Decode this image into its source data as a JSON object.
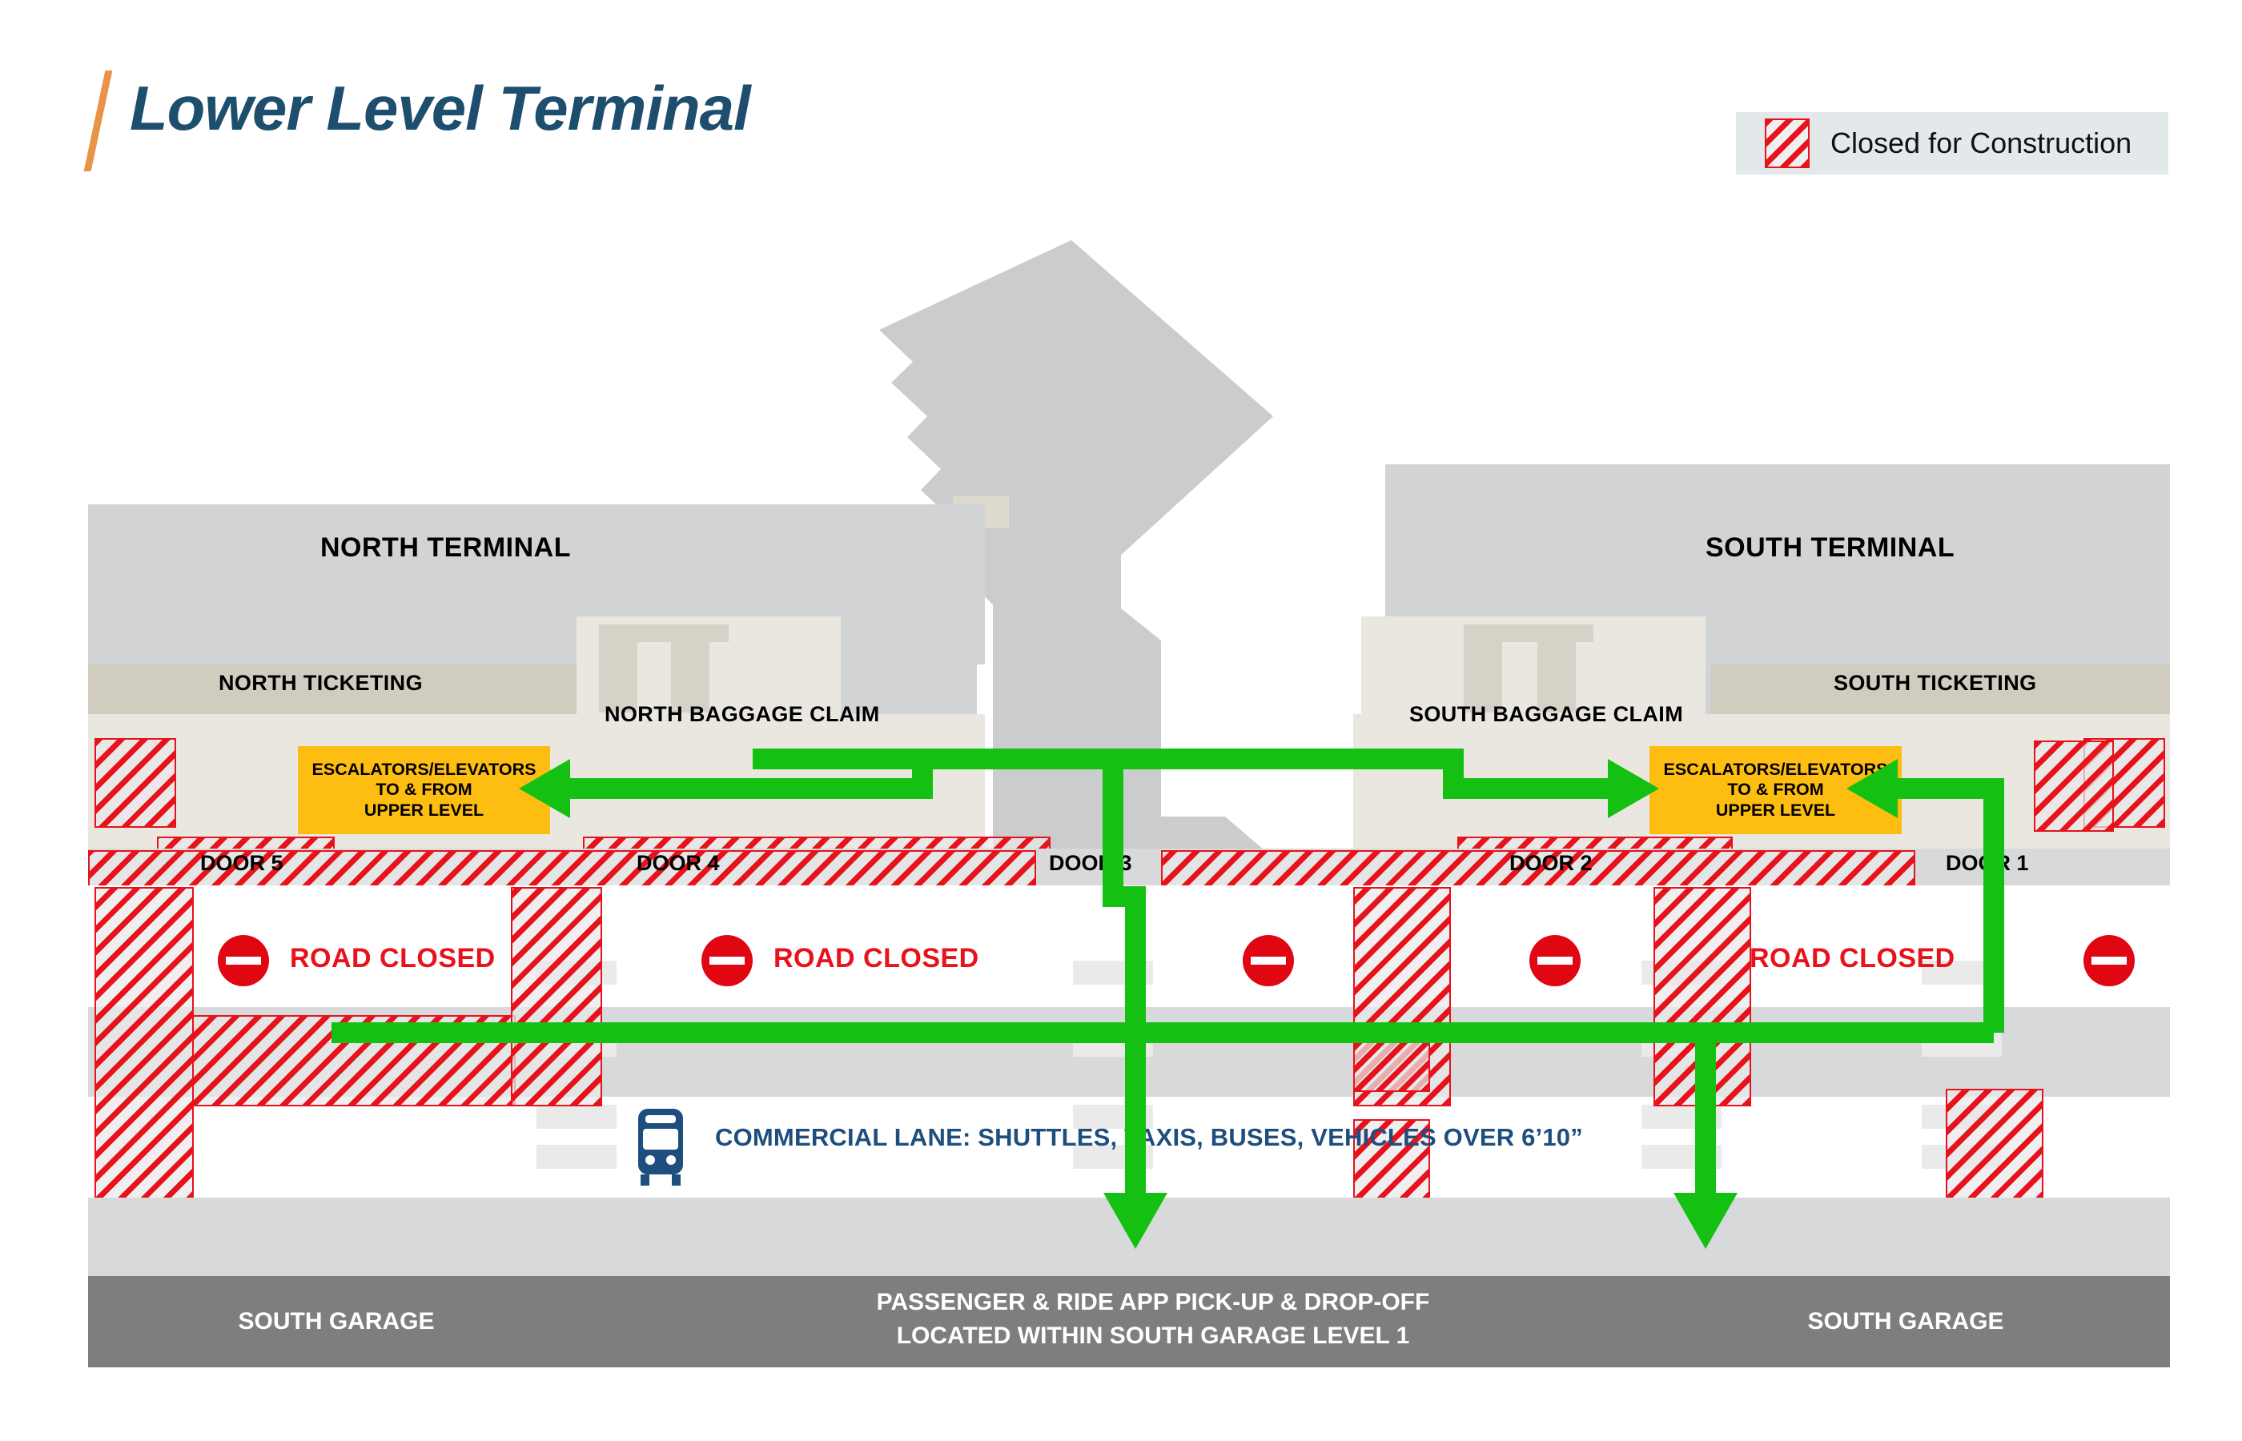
{
  "header": {
    "title": "Lower Level Terminal",
    "legend": {
      "label": "Closed for Construction",
      "swatch_icon": "hatched-square-icon"
    }
  },
  "colors": {
    "accent_orange": "#e89347",
    "title_blue": "#1d4e6e",
    "construction_red": "#e8121c",
    "route_green": "#14c113",
    "escalator_yellow": "#febd11",
    "commercial_blue": "#1d4e7d",
    "garage_grey": "#7e7e7e",
    "building_grey": "#d2d3d5",
    "ticketing_tan": "#d0ccc0",
    "claim_cream": "#e9e7e0"
  },
  "map": {
    "areas": {
      "north_terminal": "NORTH TERMINAL",
      "south_terminal": "SOUTH TERMINAL",
      "north_ticketing": "NORTH TICKETING",
      "south_ticketing": "SOUTH TICKETING",
      "north_baggage_claim": "NORTH BAGGAGE CLAIM",
      "south_baggage_claim": "SOUTH BAGGAGE CLAIM"
    },
    "escalators": {
      "north": {
        "line1": "ESCALATORS/ELEVATORS",
        "line2": "TO & FROM",
        "line3": "UPPER LEVEL"
      },
      "south": {
        "line1": "ESCALATORS/ELEVATORS",
        "line2": "TO & FROM",
        "line3": "UPPER LEVEL"
      }
    },
    "doors": [
      {
        "id": "door-5",
        "label": "DOOR 5"
      },
      {
        "id": "door-4",
        "label": "DOOR 4"
      },
      {
        "id": "door-3",
        "label": "DOOR 3"
      },
      {
        "id": "door-2",
        "label": "DOOR 2"
      },
      {
        "id": "door-1",
        "label": "DOOR 1"
      }
    ],
    "road_closed_labels": [
      {
        "id": "road-closed-north",
        "label": "ROAD CLOSED"
      },
      {
        "id": "road-closed-center",
        "label": "ROAD CLOSED"
      },
      {
        "id": "road-closed-south",
        "label": "ROAD CLOSED"
      }
    ],
    "no_entry_count": 5,
    "commercial_lane": {
      "icon": "bus-icon",
      "label": "COMMERCIAL LANE: SHUTTLES, TAXIS, BUSES, VEHICLES OVER 6’10”"
    },
    "garage": {
      "left_label": "SOUTH GARAGE",
      "right_label": "SOUTH GARAGE",
      "center_line1": "PASSENGER & RIDE APP PICK-UP & DROP-OFF",
      "center_line2": "LOCATED WITHIN SOUTH GARAGE LEVEL 1"
    }
  }
}
